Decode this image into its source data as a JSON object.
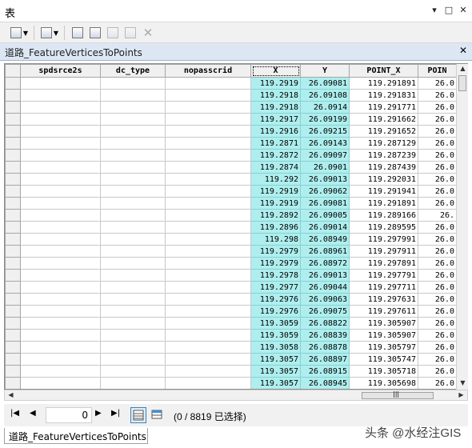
{
  "window": {
    "title": "表",
    "dropdown_glyph": "▾",
    "pin_glyph": "□",
    "close_glyph": "✕"
  },
  "toolbar": {
    "items": [
      {
        "name": "table-options-icon"
      },
      {
        "name": "related-tables-icon"
      },
      {
        "name": "select-by-attributes-icon"
      },
      {
        "name": "switch-selection-icon"
      },
      {
        "name": "clear-selection-icon"
      },
      {
        "name": "zoom-to-selected-icon"
      },
      {
        "name": "delete-selected-icon"
      }
    ],
    "delete_glyph": "✕"
  },
  "table_tab": {
    "name": "道路_FeatureVerticesToPoints",
    "close": "✕"
  },
  "columns": [
    "spdsrce2s",
    "dc_type",
    "nopasscrid",
    "X",
    "Y",
    "POINT_X",
    "POIN"
  ],
  "rows": [
    [
      "119.2919",
      "26.09081",
      "119.291891",
      "26.0"
    ],
    [
      "119.2918",
      "26.09108",
      "119.291831",
      "26.0"
    ],
    [
      "119.2918",
      "26.0914",
      "119.291771",
      "26.0"
    ],
    [
      "119.2917",
      "26.09199",
      "119.291662",
      "26.0"
    ],
    [
      "119.2916",
      "26.09215",
      "119.291652",
      "26.0"
    ],
    [
      "119.2871",
      "26.09143",
      "119.287129",
      "26.0"
    ],
    [
      "119.2872",
      "26.09097",
      "119.287239",
      "26.0"
    ],
    [
      "119.2874",
      "26.0901",
      "119.287439",
      "26.0"
    ],
    [
      "119.292",
      "26.09013",
      "119.292031",
      "26.0"
    ],
    [
      "119.2919",
      "26.09062",
      "119.291941",
      "26.0"
    ],
    [
      "119.2919",
      "26.09081",
      "119.291891",
      "26.0"
    ],
    [
      "119.2892",
      "26.09005",
      "119.289166",
      "26."
    ],
    [
      "119.2896",
      "26.09014",
      "119.289595",
      "26.0"
    ],
    [
      "119.298",
      "26.08949",
      "119.297991",
      "26.0"
    ],
    [
      "119.2979",
      "26.08961",
      "119.297911",
      "26.0"
    ],
    [
      "119.2979",
      "26.08972",
      "119.297891",
      "26.0"
    ],
    [
      "119.2978",
      "26.09013",
      "119.297791",
      "26.0"
    ],
    [
      "119.2977",
      "26.09044",
      "119.297711",
      "26.0"
    ],
    [
      "119.2976",
      "26.09063",
      "119.297631",
      "26.0"
    ],
    [
      "119.2976",
      "26.09075",
      "119.297611",
      "26.0"
    ],
    [
      "119.3059",
      "26.08822",
      "119.305907",
      "26.0"
    ],
    [
      "119.3059",
      "26.08839",
      "119.305907",
      "26.0"
    ],
    [
      "119.3058",
      "26.08878",
      "119.305797",
      "26.0"
    ],
    [
      "119.3057",
      "26.08897",
      "119.305747",
      "26.0"
    ],
    [
      "119.3057",
      "26.08915",
      "119.305718",
      "26.0"
    ],
    [
      "119.3057",
      "26.08945",
      "119.305698",
      "26.0"
    ]
  ],
  "scroll": {
    "up": "▲",
    "down": "▼",
    "left": "◀",
    "right": "▶",
    "grip": "|||"
  },
  "navigation": {
    "first": "|◀",
    "prev": "◀",
    "next": "▶",
    "last": "▶|",
    "current_record": "0",
    "status": "(0 / 8819 已选择)"
  },
  "bottom_tab": "道路_FeatureVerticesToPoints",
  "watermark": "头条 @水经注GIS",
  "colors": {
    "highlight": "#aeeeee",
    "tab_bar": "#dde7f4"
  }
}
